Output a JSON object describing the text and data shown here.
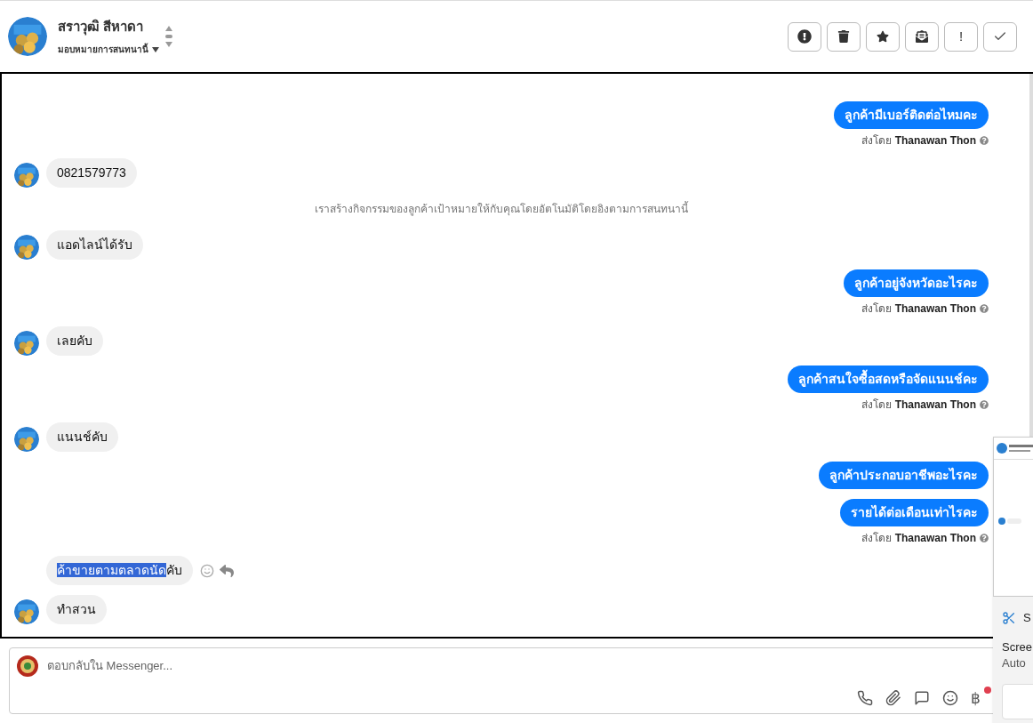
{
  "header": {
    "name": "สราวุฒิ สีหาดา",
    "assign": "มอบหมายการสนทนานี้",
    "actions": [
      {
        "kind": "alert"
      },
      {
        "kind": "trash"
      },
      {
        "kind": "star"
      },
      {
        "kind": "envelope"
      },
      {
        "kind": "exclaim",
        "label": "!"
      },
      {
        "kind": "check"
      }
    ]
  },
  "messages": [
    {
      "kind": "sent",
      "text": "ลูกค้ามีเบอร์ติดต่อไหมคะ",
      "sent_by": "ส่งโดย",
      "sender": "Thanawan Thon"
    },
    {
      "kind": "received",
      "avatar": true,
      "parts": [
        {
          "text": "0821579773",
          "selected": false
        }
      ],
      "hovered": false
    },
    {
      "kind": "system",
      "text": "เราสร้างกิจกรรมของลูกค้าเป้าหมายให้กับคุณโดยอัตโนมัติโดยอิงตามการสนทนานี้"
    },
    {
      "kind": "received",
      "avatar": true,
      "parts": [
        {
          "text": "แอดไลน์ได้รับ",
          "selected": false
        }
      ],
      "hovered": false
    },
    {
      "kind": "sent",
      "text": "ลูกค้าอยู่จังหวัดอะไรคะ",
      "sent_by": "ส่งโดย",
      "sender": "Thanawan Thon"
    },
    {
      "kind": "received",
      "avatar": true,
      "parts": [
        {
          "text": "เลยคับ",
          "selected": false
        }
      ],
      "hovered": false
    },
    {
      "kind": "sent",
      "text": "ลูกค้าสนใจซื้อสดหรือจัดแนนช์คะ",
      "sent_by": "ส่งโดย",
      "sender": "Thanawan Thon"
    },
    {
      "kind": "received",
      "avatar": true,
      "parts": [
        {
          "text": "แนนช์คับ",
          "selected": false
        }
      ],
      "hovered": false
    },
    {
      "kind": "sent",
      "text": "ลูกค้าประกอบอาชีพอะไรคะ"
    },
    {
      "kind": "sent",
      "text": "รายได้ต่อเดือนเท่าไรคะ",
      "sent_by": "ส่งโดย",
      "sender": "Thanawan Thon"
    },
    {
      "kind": "received",
      "avatar": false,
      "parts": [
        {
          "text": "ค้าขายตามตลาดนัด",
          "selected": true
        },
        {
          "text": "คับ",
          "selected": false
        }
      ],
      "hovered": true
    },
    {
      "kind": "received",
      "avatar": true,
      "parts": [
        {
          "text": "ทำสวน",
          "selected": false
        }
      ],
      "hovered": false
    }
  ],
  "composer": {
    "placeholder": "ตอบกลับใน Messenger...",
    "tools": [
      {
        "kind": "phone"
      },
      {
        "kind": "clip"
      },
      {
        "kind": "chat"
      },
      {
        "kind": "emoji"
      },
      {
        "kind": "baht",
        "label": "฿",
        "alert": true
      }
    ]
  },
  "snip_notification": {
    "title": "S",
    "line_1": "Scree",
    "line_2": "Auto"
  }
}
